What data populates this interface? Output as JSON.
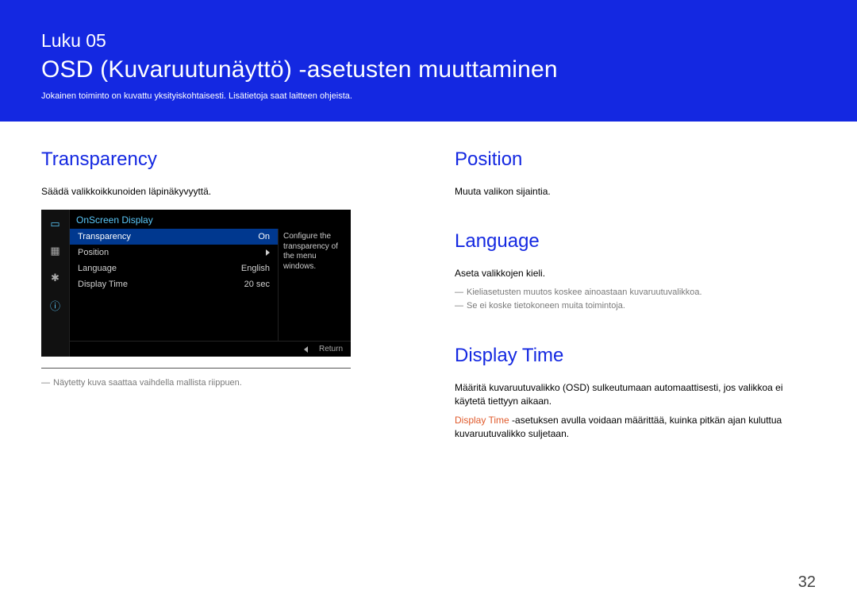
{
  "banner": {
    "chapter": "Luku 05",
    "title": "OSD (Kuvaruutunäyttö) -asetusten muuttaminen",
    "subtitle": "Jokainen toiminto on kuvattu yksityiskohtaisesti. Lisätietoja saat laitteen ohjeista."
  },
  "transparency": {
    "heading": "Transparency",
    "body": "Säädä valikkoikkunoiden läpinäkyvyyttä.",
    "footnote": "Näytetty kuva saattaa vaihdella mallista riippuen."
  },
  "osd": {
    "header": "OnScreen Display",
    "rows": [
      {
        "label": "Transparency",
        "value": "On"
      },
      {
        "label": "Position",
        "value": ""
      },
      {
        "label": "Language",
        "value": "English"
      },
      {
        "label": "Display Time",
        "value": "20 sec"
      }
    ],
    "info": "Configure the transparency of the menu windows.",
    "return_label": "Return"
  },
  "position": {
    "heading": "Position",
    "body": "Muuta valikon sijaintia."
  },
  "language": {
    "heading": "Language",
    "body": "Aseta valikkojen kieli.",
    "note1": "Kieliasetusten muutos koskee ainoastaan kuvaruutuvalikkoa.",
    "note2": "Se ei koske tietokoneen muita toimintoja."
  },
  "display_time": {
    "heading": "Display Time",
    "body1": "Määritä kuvaruutuvalikko (OSD) sulkeutumaan automaattisesti, jos valikkoa ei käytetä tiettyyn aikaan.",
    "label": "Display Time",
    "body2": " -asetuksen avulla voidaan määrittää, kuinka pitkän ajan kuluttua kuvaruutuvalikko suljetaan."
  },
  "page_number": "32"
}
